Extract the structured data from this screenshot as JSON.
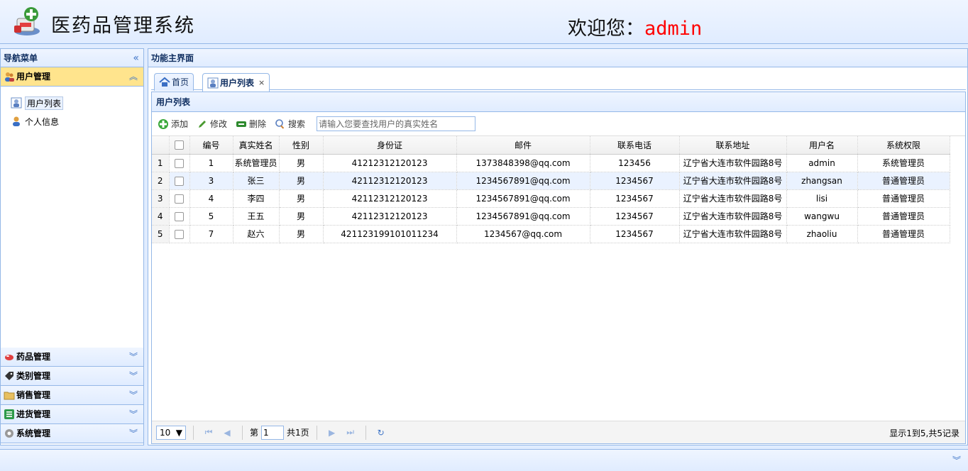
{
  "header": {
    "app_title": "医药品管理系统",
    "welcome_prefix": "欢迎您：",
    "username": "admin"
  },
  "nav": {
    "title": "导航菜单",
    "collapse_icon": "double-chevron-left-icon",
    "sections": [
      {
        "label": "用户管理",
        "icon": "user-group-icon",
        "expanded": true
      },
      {
        "label": "药品管理",
        "icon": "pill-icon",
        "expanded": false
      },
      {
        "label": "类别管理",
        "icon": "tag-icon",
        "expanded": false
      },
      {
        "label": "销售管理",
        "icon": "folder-icon",
        "expanded": false
      },
      {
        "label": "进货管理",
        "icon": "list-icon",
        "expanded": false
      },
      {
        "label": "系统管理",
        "icon": "gear-icon",
        "expanded": false
      }
    ],
    "user_links": [
      {
        "label": "用户列表",
        "icon": "user-list-icon",
        "selected": true
      },
      {
        "label": "个人信息",
        "icon": "person-icon",
        "selected": false
      }
    ]
  },
  "main": {
    "title": "功能主界面",
    "tabs": [
      {
        "label": "首页",
        "icon": "home-icon",
        "selected": false,
        "closable": false
      },
      {
        "label": "用户列表",
        "icon": "user-list-icon",
        "selected": true,
        "closable": true
      }
    ]
  },
  "grid": {
    "title": "用户列表",
    "toolbar": {
      "add": "添加",
      "edit": "修改",
      "delete": "删除",
      "search": "搜索",
      "search_placeholder": "请输入您要查找用户的真实姓名"
    },
    "columns": [
      "编号",
      "真实姓名",
      "性别",
      "身份证",
      "邮件",
      "联系电话",
      "联系地址",
      "用户名",
      "系统权限"
    ],
    "rows": [
      {
        "rownum": "1",
        "id": "1",
        "name": "系统管理员",
        "gender": "男",
        "idcard": "41212312120123",
        "email": "1373848398@qq.com",
        "phone": "123456",
        "address": "辽宁省大连市软件园路8号",
        "username": "admin",
        "role": "系统管理员"
      },
      {
        "rownum": "2",
        "id": "3",
        "name": "张三",
        "gender": "男",
        "idcard": "42112312120123",
        "email": "1234567891@qq.com",
        "phone": "1234567",
        "address": "辽宁省大连市软件园路8号",
        "username": "zhangsan",
        "role": "普通管理员"
      },
      {
        "rownum": "3",
        "id": "4",
        "name": "李四",
        "gender": "男",
        "idcard": "42112312120123",
        "email": "1234567891@qq.com",
        "phone": "1234567",
        "address": "辽宁省大连市软件园路8号",
        "username": "lisi",
        "role": "普通管理员"
      },
      {
        "rownum": "4",
        "id": "5",
        "name": "王五",
        "gender": "男",
        "idcard": "42112312120123",
        "email": "1234567891@qq.com",
        "phone": "1234567",
        "address": "辽宁省大连市软件园路8号",
        "username": "wangwu",
        "role": "普通管理员"
      },
      {
        "rownum": "5",
        "id": "7",
        "name": "赵六",
        "gender": "男",
        "idcard": "421123199101011234",
        "email": "1234567@qq.com",
        "phone": "1234567",
        "address": "辽宁省大连市软件园路8号",
        "username": "zhaoliu",
        "role": "普通管理员"
      }
    ],
    "pager": {
      "page_size": "10",
      "page_prefix": "第",
      "page_value": "1",
      "page_suffix": "共1页",
      "info": "显示1到5,共5记录"
    }
  },
  "colors": {
    "border": "#95b8e7",
    "header_bg": "#e0ecff",
    "active_section": "#ffe48d",
    "username": "#ff0000",
    "highlight_row": "#eaf2ff"
  }
}
